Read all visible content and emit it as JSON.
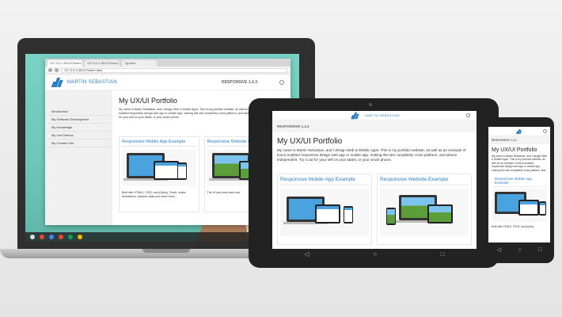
{
  "laptop": {
    "tabs": [
      "127.0.0.1:55137/index.html",
      "127.0.0.1:55137/index",
      "Typeset"
    ],
    "url": "127.0.0.1:55137/index.html",
    "logo_text": "MARTIN SEBASTIAN",
    "header_version": "RESPONSIVE 1.4.3",
    "sidebar_items": [
      "Introduction",
      "My Software Development",
      "My Knowledge",
      "My Live Demos",
      "My Contact Info"
    ],
    "page_title": "My UX/UI Portfolio",
    "intro": "My name is Martin Sebastian, and I design Web & Mobile Apps. This is my portfolio website, as well as an example of touch enabled responsive design web app or mobile app, making this site completely cross platform, and device independent. Try it out for your self on your tablet, or your smart phone.",
    "card1_title": "Responsive Mobile App Example",
    "card1_text": "Built with HTML5, CSS3, and jQuery. Touch, swipe, animations, dynamic data and much more.",
    "card2_title": "Responsive Website Example",
    "card2_text": "The UI and fonts auto size"
  },
  "tablet": {
    "version": "RESPONSIVE 1.4.3",
    "page_title": "My UX/UI Portfolio",
    "intro": "My name is Martin Sebastian, and I design Web & Mobile Apps. This is my portfolio website, as well as an example of touch enabled responsive design web app or mobile app, making this site completely cross platform, and device independent. Try it out for your self on your tablet, or your smart phone.",
    "card1_title": "Responsive Mobile App Example",
    "card2_title": "Responsive Website Example"
  },
  "phone": {
    "version": "RESPONSIVE 1.4.3",
    "page_title": "My UX/UI Portfolio",
    "intro": "My name is Martin Sebastian, and I design Web & Mobile Apps. This is my portfolio website, as well as an example of touch enabled responsive design web app or mobile app, making this site completely cross platform, and device independent. Try it out for your self on your tablet, or your smart phone.",
    "card_title": "Responsive Mobile App Example",
    "card_text": "Built with HTML5, CSS3, and jQuery."
  },
  "icons": {
    "back": "back-icon",
    "home": "home-icon",
    "recent": "recent-apps-icon",
    "search": "search-icon"
  },
  "colors": {
    "brand_blue": "#2b7fc4",
    "wallpaper_teal": "#79d2c4",
    "wallpaper_rust": "#b9724d"
  }
}
